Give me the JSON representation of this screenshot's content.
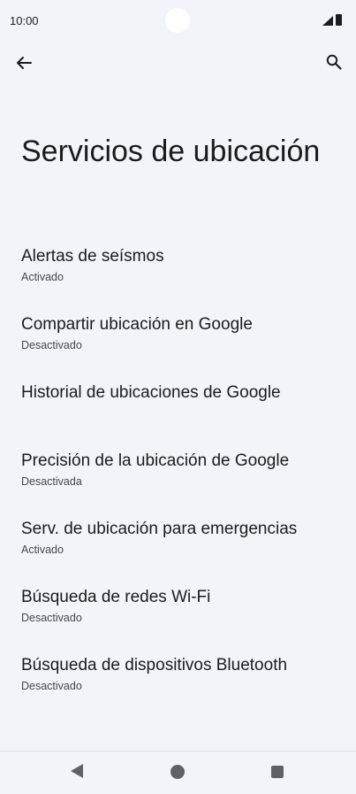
{
  "status_bar": {
    "time": "10:00"
  },
  "header": {
    "back_icon": "arrow-back-icon",
    "search_icon": "search-icon"
  },
  "page": {
    "title": "Servicios de ubicación"
  },
  "settings": [
    {
      "title": "Alertas de seísmos",
      "summary": "Activado"
    },
    {
      "title": "Compartir ubicación en Google",
      "summary": "Desactivado"
    },
    {
      "title": "Historial de ubicaciones de Google",
      "summary": ""
    },
    {
      "title": "Precisión de la ubicación de Google",
      "summary": "Desactivada"
    },
    {
      "title": "Serv. de ubicación para emergencias",
      "summary": "Activado"
    },
    {
      "title": "Búsqueda de redes Wi-Fi",
      "summary": "Desactivado"
    },
    {
      "title": "Búsqueda de dispositivos Bluetooth",
      "summary": "Desactivado"
    }
  ],
  "nav_bar": {
    "back": "nav-back-icon",
    "home": "nav-home-icon",
    "recents": "nav-recents-icon"
  }
}
